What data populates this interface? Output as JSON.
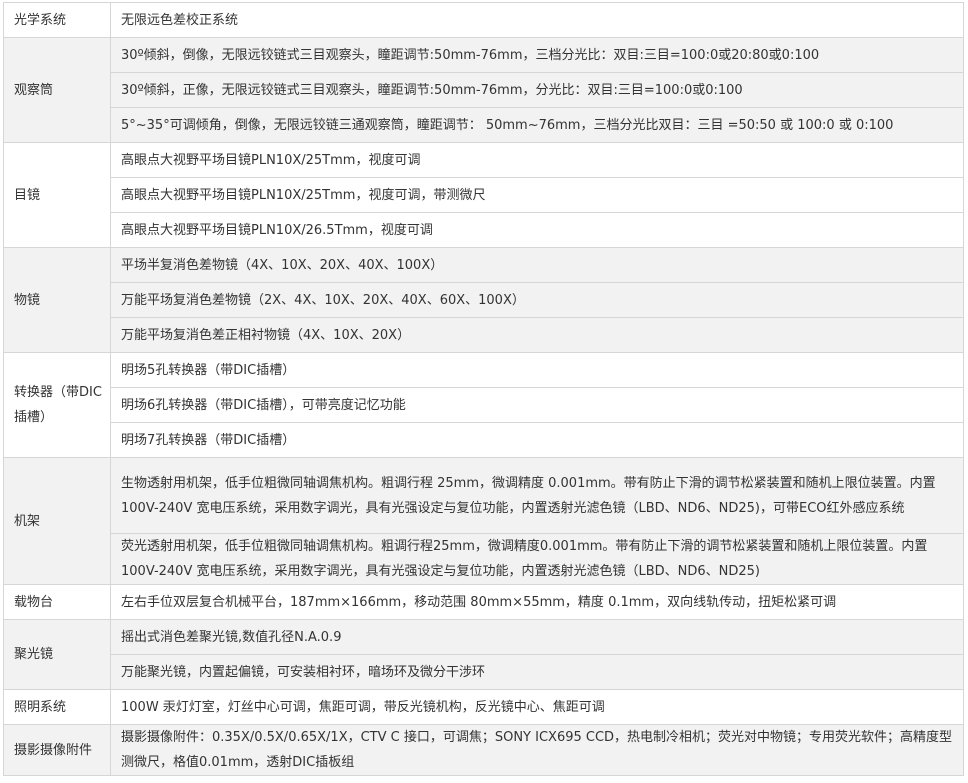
{
  "rows": [
    {
      "category": "光学系统",
      "items": [
        "无限远色差校正系统"
      ]
    },
    {
      "category": "观察筒",
      "items": [
        "30º倾斜，倒像，无限远铰链式三目观察头，瞳距调节:50mm-76mm，三档分光比：双目:三目=100:0或20:80或0:100",
        "30º倾斜，正像，无限远铰链式三目观察头，瞳距调节:50mm-76mm，分光比：双目:三目=100:0或0:100",
        "5°~35°可调倾角，倒像，无限远铰链三通观察筒，瞳距调节： 50mm~76mm，三档分光比双目：三目 =50:50 或 100:0 或 0:100"
      ]
    },
    {
      "category": "目镜",
      "items": [
        "高眼点大视野平场目镜PLN10X/25Tmm，视度可调",
        "高眼点大视野平场目镜PLN10X/25Tmm，视度可调，带测微尺",
        "高眼点大视野平场目镜PLN10X/26.5Tmm，视度可调"
      ]
    },
    {
      "category": "物镜",
      "items": [
        "平场半复消色差物镜（4X、10X、20X、40X、100X）",
        "万能平场复消色差物镜（2X、4X、10X、20X、40X、60X、100X）",
        "万能平场复消色差正相衬物镜（4X、10X、20X）"
      ]
    },
    {
      "category": "转换器（带DIC插槽）",
      "items": [
        "明场5孔转换器（带DIC插槽）",
        "明场6孔转换器（带DIC插槽），可带亮度记忆功能",
        "明场7孔转换器（带DIC插槽）"
      ]
    },
    {
      "category": "机架",
      "items": [
        "生物透射用机架，低手位粗微同轴调焦机构。粗调行程 25mm，微调精度 0.001mm。带有防止下滑的调节松紧装置和随机上限位装置。内置 100V-240V 宽电压系统，采用数字调光，具有光强设定与复位功能，内置透射光滤色镜（LBD、ND6、ND25)，可带ECO红外感应系统",
        "荧光透射用机架，低手位粗微同轴调焦机构。粗调行程25mm，微调精度0.001mm。带有防止下滑的调节松紧装置和随机上限位装置。内置 100V-240V 宽电压系统，采用数字调光，具有光强设定与复位功能，内置透射光滤色镜（LBD、ND6、ND25)"
      ]
    },
    {
      "category": "载物台",
      "items": [
        "左右手位双层复合机械平台，187mm×166mm，移动范围 80mm×55mm，精度 0.1mm，双向线轨传动，扭矩松紧可调"
      ]
    },
    {
      "category": "聚光镜",
      "items": [
        "摇出式消色差聚光镜,数值孔径N.A.0.9",
        "万能聚光镜，内置起偏镜，可安装相衬环，暗场环及微分干涉环"
      ]
    },
    {
      "category": "照明系统",
      "items": [
        "100W 汞灯灯室，灯丝中心可调，焦距可调，带反光镜机构，反光镜中心、焦距可调"
      ]
    },
    {
      "category": "摄影摄像附件",
      "items": [
        "摄影摄像附件：0.35X/0.5X/0.65X/1X，CTV C 接口，可调焦；SONY ICX695 CCD，热电制冷相机；荧光对中物镜；专用荧光软件；高精度型测微尺，格值0.01mm，透射DIC插板组"
      ]
    }
  ]
}
